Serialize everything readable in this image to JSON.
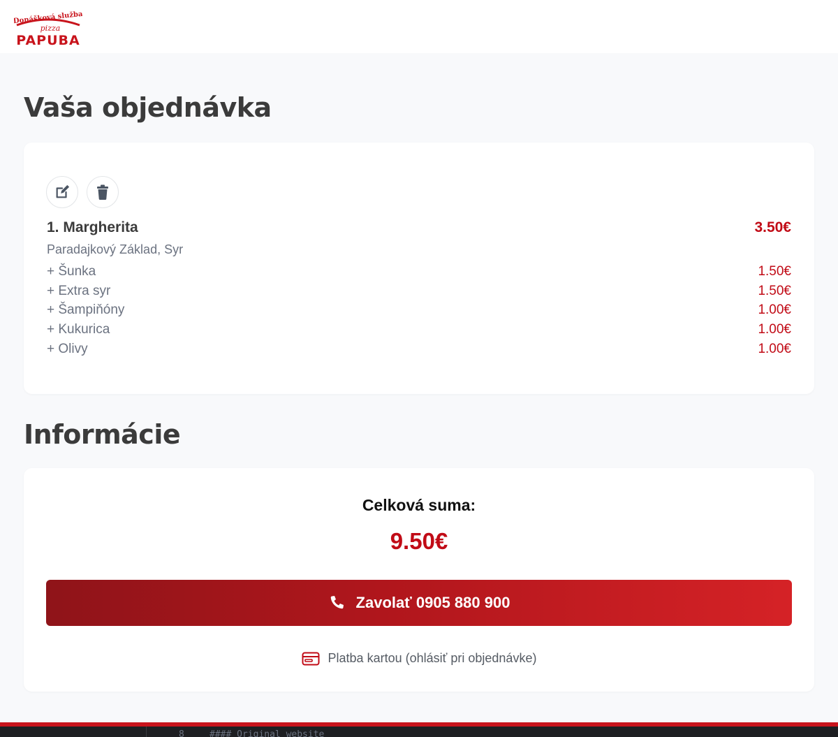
{
  "brand": {
    "logo_top_text": "Donášková služba",
    "logo_middle_text": "pizza",
    "logo_name": "PAPUBA"
  },
  "order": {
    "title": "Vaša objednávka",
    "item": {
      "name": "1. Margherita",
      "price": "3.50€",
      "description": "Paradajkový Základ, Syr",
      "extras": [
        {
          "name": "+ Šunka",
          "price": "1.50€"
        },
        {
          "name": "+ Extra syr",
          "price": "1.50€"
        },
        {
          "name": "+ Šampiňóny",
          "price": "1.00€"
        },
        {
          "name": "+ Kukurica",
          "price": "1.00€"
        },
        {
          "name": "+ Olivy",
          "price": "1.00€"
        }
      ]
    },
    "icons": {
      "edit": "edit-icon",
      "delete": "trash-icon"
    }
  },
  "info": {
    "title": "Informácie",
    "total_label": "Celková suma:",
    "total_value": "9.50€",
    "call_label": "Zavolať 0905 880 900",
    "payment_note": "Platba kartou (ohlásiť pri objednávke)"
  },
  "colors": {
    "accent": "#c10b16",
    "heading": "#3b3b3b",
    "muted": "#6b7280",
    "background": "#f8f9fb"
  },
  "code_strip": {
    "line_number": "8",
    "text": "#### Original website"
  }
}
